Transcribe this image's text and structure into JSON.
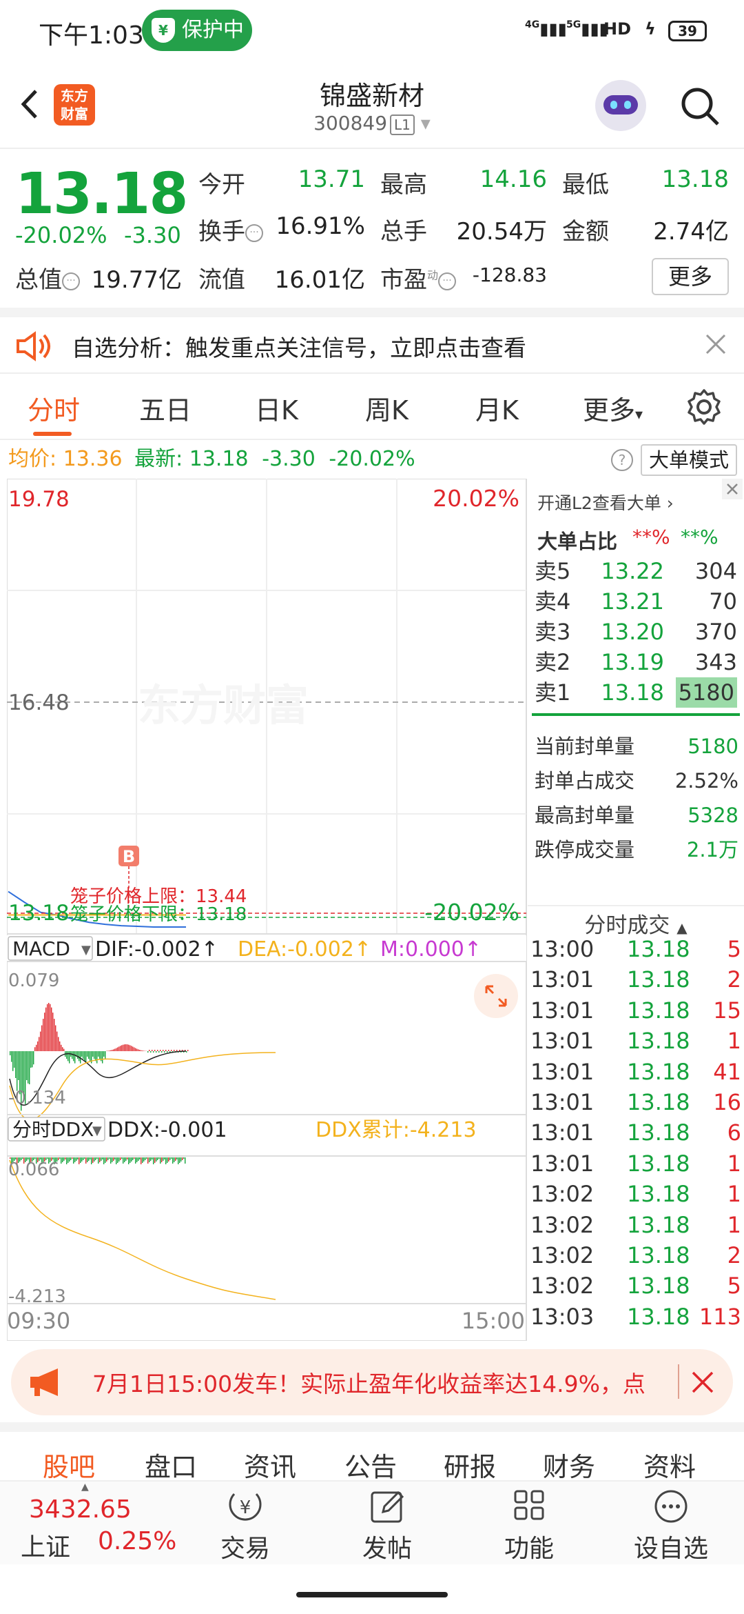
{
  "status_bar": {
    "time": "下午1:03",
    "protect_label": "保护中",
    "signal1": "4G",
    "signal2": "5G",
    "hd": "HD",
    "battery": "39"
  },
  "nav": {
    "title": "锦盛新材",
    "code": "300849",
    "level": "L1",
    "logo_text": "东方财富"
  },
  "quote": {
    "price": "13.18",
    "change_pct": "-20.02%",
    "change": "-3.30",
    "rows": [
      {
        "l1": "今开",
        "v1": "13.71",
        "l2": "最高",
        "v2": "14.16",
        "l3": "最低",
        "v3": "13.18"
      },
      {
        "l1": "换手",
        "v1": "16.91%",
        "l2": "总手",
        "v2": "20.54万",
        "l3": "金额",
        "v3": "2.74亿"
      },
      {
        "l1": "总值",
        "v1": "19.77亿",
        "l2": "流值",
        "v2": "16.01亿",
        "l3": "市盈",
        "v3": "-128.83"
      }
    ],
    "pe_sup": "动",
    "more_label": "更多"
  },
  "banner1": {
    "text": "自选分析：触发重点关注信号，立即点击查看"
  },
  "tabs": [
    {
      "label": "分时",
      "active": true
    },
    {
      "label": "五日"
    },
    {
      "label": "日K"
    },
    {
      "label": "周K"
    },
    {
      "label": "月K"
    },
    {
      "label": "更多"
    }
  ],
  "avg_bar": {
    "avg_label": "均价:",
    "avg_value": "13.36",
    "latest_label": "最新:",
    "latest_value": "13.18",
    "latest_change": "-3.30",
    "latest_pct": "-20.02%",
    "mode_button": "大单模式"
  },
  "chart": {
    "price_top": "19.78",
    "pct_top": "20.02%",
    "price_mid": "16.48",
    "price_bottom": "13.18",
    "pct_bottom": "-20.02%",
    "watermark": "东方财富",
    "upper_limit": "笼子价格上限：13.44",
    "lower_limit": "笼子价格下限：13.18",
    "buy_marker": "B",
    "macd_label": "MACD",
    "dif": "DIF:-0.002↑",
    "dea": "DEA:-0.002↑",
    "m": "M:0.000↑",
    "macd_top": "0.079",
    "macd_bottom": "-0.134",
    "ddx_label": "分时DDX",
    "ddx": "DDX:-0.001",
    "ddx_sum": "DDX累计:-4.213",
    "ddx_top": "0.066",
    "ddx_bottom": "-4.213",
    "time_start": "09:30",
    "time_end": "15:00"
  },
  "chart_data": {
    "type": "line",
    "title": "",
    "xlabel": "",
    "ylabel": "",
    "x_range": [
      "09:30",
      "15:00"
    ],
    "ylim": [
      13.18,
      19.78
    ],
    "series": [
      {
        "values": [
          13.71,
          13.55,
          13.4,
          13.36,
          13.3,
          13.25,
          13.22,
          13.2,
          13.19,
          13.18,
          13.18,
          13.18
        ]
      }
    ],
    "colors": {
      "price_line": "#2f6fdb",
      "avg_line": "#f3b21d"
    }
  },
  "orders": {
    "link": "开通L2查看大单",
    "ratio_label": "大单占比",
    "ratio_red": "**%",
    "ratio_green": "**%",
    "asks": [
      {
        "label": "卖5",
        "price": "13.22",
        "vol": "304"
      },
      {
        "label": "卖4",
        "price": "13.21",
        "vol": "70"
      },
      {
        "label": "卖3",
        "price": "13.20",
        "vol": "370"
      },
      {
        "label": "卖2",
        "price": "13.19",
        "vol": "343"
      },
      {
        "label": "卖1",
        "price": "13.18",
        "vol": "5180"
      }
    ],
    "stats": [
      {
        "label": "当前封单量",
        "value": "5180"
      },
      {
        "label": "封单占成交",
        "value": "2.52%"
      },
      {
        "label": "最高封单量",
        "value": "5328"
      },
      {
        "label": "跌停成交量",
        "value": "2.1万"
      }
    ]
  },
  "ticks": {
    "title": "分时成交",
    "rows": [
      {
        "t": "13:00",
        "p": "13.18",
        "v": "5"
      },
      {
        "t": "13:01",
        "p": "13.18",
        "v": "2"
      },
      {
        "t": "13:01",
        "p": "13.18",
        "v": "15"
      },
      {
        "t": "13:01",
        "p": "13.18",
        "v": "1"
      },
      {
        "t": "13:01",
        "p": "13.18",
        "v": "41"
      },
      {
        "t": "13:01",
        "p": "13.18",
        "v": "16"
      },
      {
        "t": "13:01",
        "p": "13.18",
        "v": "6"
      },
      {
        "t": "13:01",
        "p": "13.18",
        "v": "1"
      },
      {
        "t": "13:02",
        "p": "13.18",
        "v": "1"
      },
      {
        "t": "13:02",
        "p": "13.18",
        "v": "1"
      },
      {
        "t": "13:02",
        "p": "13.18",
        "v": "2"
      },
      {
        "t": "13:02",
        "p": "13.18",
        "v": "5"
      },
      {
        "t": "13:03",
        "p": "13.18",
        "v": "113"
      }
    ]
  },
  "ad": {
    "text": "7月1日15:00发车！实际止盈年化收益率达14.9%，点"
  },
  "subtabs": [
    {
      "label": "股吧",
      "active": true
    },
    {
      "label": "盘口"
    },
    {
      "label": "资讯"
    },
    {
      "label": "公告"
    },
    {
      "label": "研报"
    },
    {
      "label": "财务"
    },
    {
      "label": "资料"
    }
  ],
  "bottom": {
    "index_value": "3432.65",
    "index_name": "上证",
    "index_pct": "0.25%",
    "buttons": [
      {
        "label": "交易",
        "icon": "yen-icon"
      },
      {
        "label": "发帖",
        "icon": "edit-icon"
      },
      {
        "label": "功能",
        "icon": "grid-icon"
      },
      {
        "label": "设自选",
        "icon": "more-icon"
      }
    ]
  }
}
